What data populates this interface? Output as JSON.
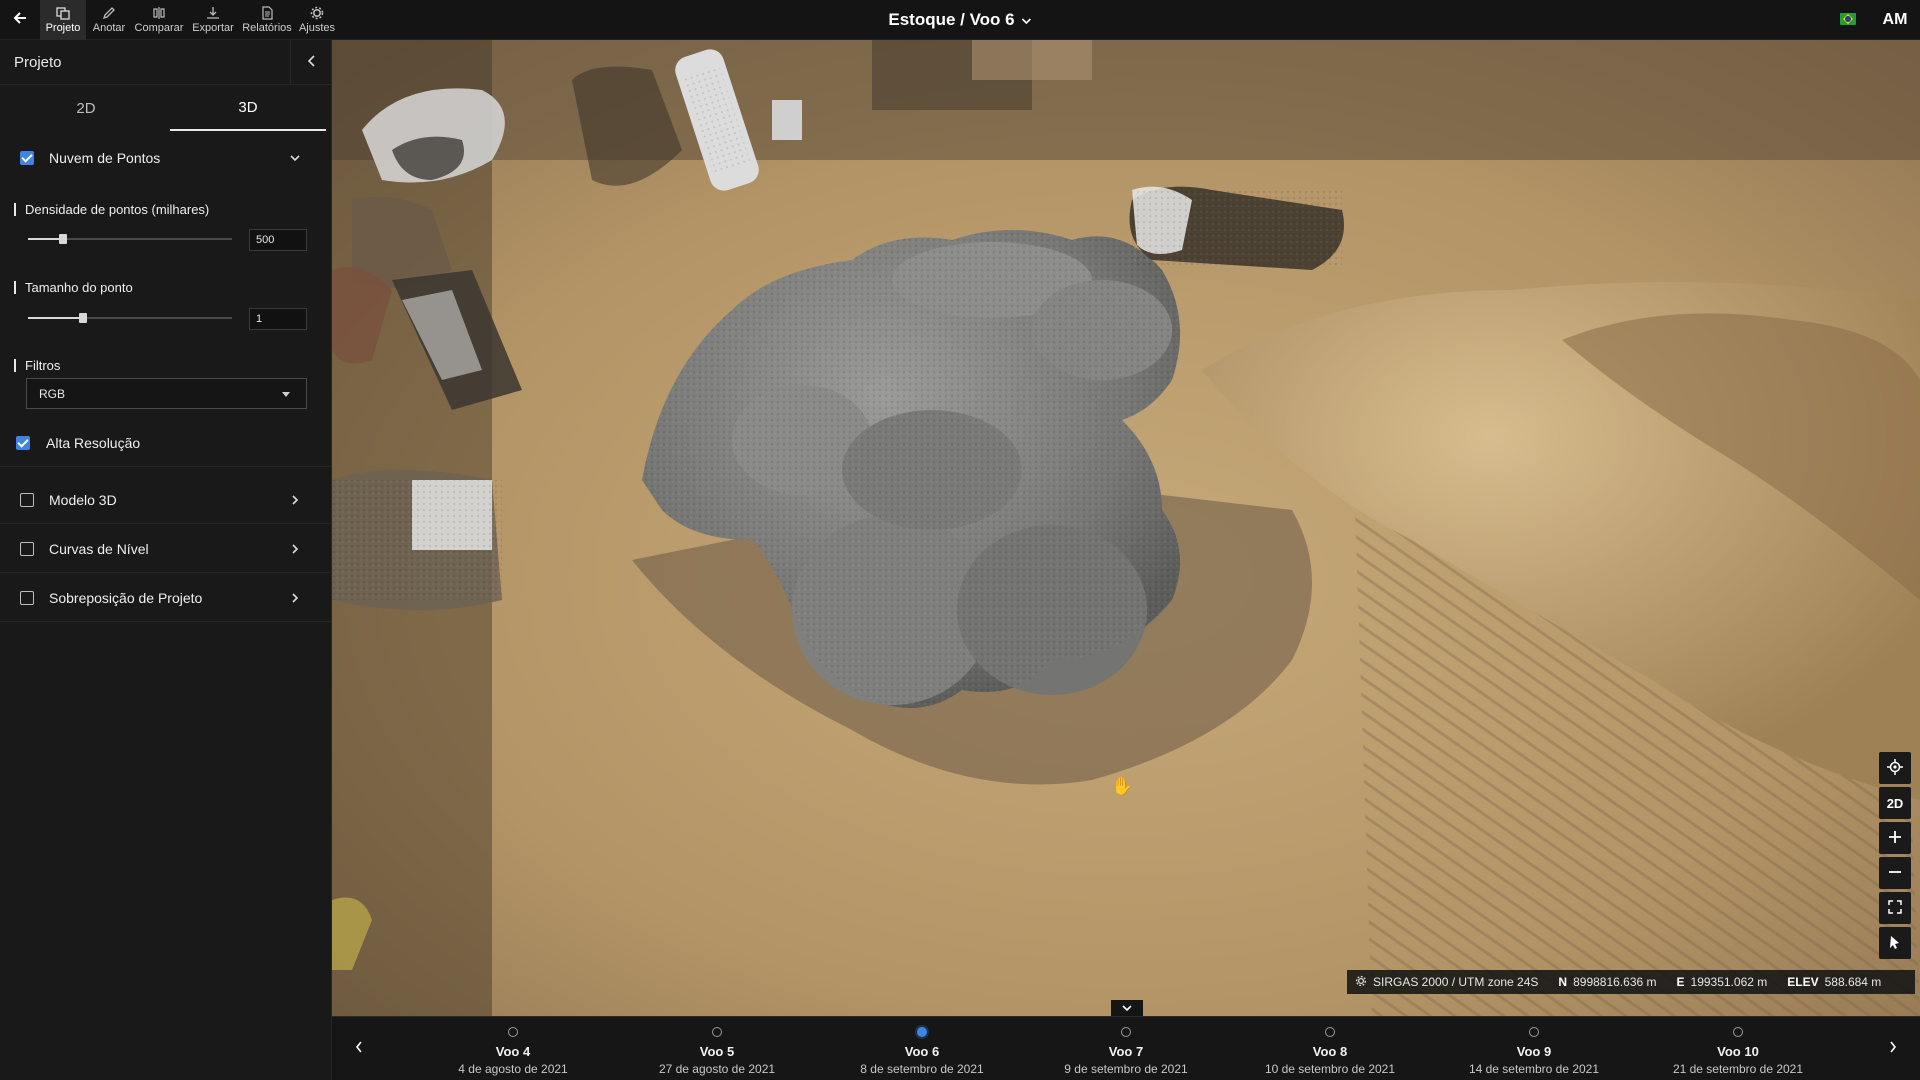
{
  "toolbar": {
    "back_icon": "arrow-left-icon",
    "tools": [
      {
        "label": "Projeto",
        "icon": "project-icon",
        "active": true
      },
      {
        "label": "Anotar",
        "icon": "pencil-icon",
        "active": false
      },
      {
        "label": "Comparar",
        "icon": "compare-icon",
        "active": false
      },
      {
        "label": "Exportar",
        "icon": "download-icon",
        "active": false
      },
      {
        "label": "Relatórios",
        "icon": "report-icon",
        "active": false
      },
      {
        "label": "Ajustes",
        "icon": "gear-icon",
        "active": false
      }
    ],
    "title": "Estoque / Voo 6",
    "language_flag": "brazil-flag-icon",
    "user_initials": "AM"
  },
  "sidebar": {
    "title": "Projeto",
    "tabs": [
      {
        "label": "2D",
        "active": false
      },
      {
        "label": "3D",
        "active": true
      }
    ],
    "point_cloud": {
      "label": "Nuvem de Pontos",
      "checked": true,
      "expanded": true,
      "density": {
        "label": "Densidade de pontos (milhares)",
        "value": "500",
        "slider_fraction": 0.17
      },
      "point_size": {
        "label": "Tamanho do ponto",
        "value": "1",
        "slider_fraction": 0.27
      },
      "filters": {
        "label": "Filtros",
        "selected": "RGB"
      },
      "high_res": {
        "label": "Alta Resolução",
        "checked": true
      }
    },
    "layers": [
      {
        "label": "Modelo 3D",
        "checked": false
      },
      {
        "label": "Curvas de Nível",
        "checked": false
      },
      {
        "label": "Sobreposição de Projeto",
        "checked": false
      }
    ]
  },
  "viewport": {
    "controls": [
      "locate-icon",
      "2D",
      "zoom-in-icon",
      "zoom-out-icon",
      "fullscreen-icon",
      "pointer-icon"
    ],
    "coordinates": {
      "crs": "SIRGAS 2000 / UTM zone 24S",
      "n_label": "N",
      "n_value": "8998816.636 m",
      "e_label": "E",
      "e_value": "199351.062 m",
      "elev_label": "ELEV",
      "elev_value": "588.684 m"
    }
  },
  "timeline": {
    "flights": [
      {
        "name": "Voo 4",
        "date": "4 de agosto de 2021",
        "active": false
      },
      {
        "name": "Voo 5",
        "date": "27 de agosto de 2021",
        "active": false
      },
      {
        "name": "Voo 6",
        "date": "8 de setembro de 2021",
        "active": true
      },
      {
        "name": "Voo 7",
        "date": "9 de setembro de 2021",
        "active": false
      },
      {
        "name": "Voo 8",
        "date": "10 de setembro de 2021",
        "active": false
      },
      {
        "name": "Voo 9",
        "date": "14 de setembro de 2021",
        "active": false
      },
      {
        "name": "Voo 10",
        "date": "21 de setembro de 2021",
        "active": false
      }
    ]
  },
  "colors": {
    "accent": "#3f84e5",
    "panel": "#191919",
    "topbar": "#141414",
    "ground": "#b89a6c",
    "gravel": "#7d7d7d"
  }
}
